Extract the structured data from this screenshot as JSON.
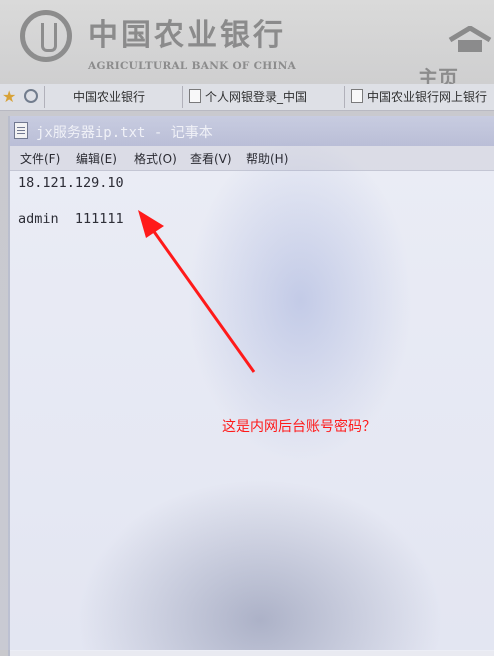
{
  "banner": {
    "bank_name_cn": "中国农业银行",
    "bank_name_en": "AGRICULTURAL BANK OF CHINA",
    "home_label": "主页"
  },
  "tabs": [
    {
      "label": "中国农业银行"
    },
    {
      "label": "个人网银登录_中国"
    },
    {
      "label": "中国农业银行网上银行"
    }
  ],
  "notepad": {
    "title": "jx服务器ip.txt - 记事本",
    "menu": [
      "文件(F)",
      "编辑(E)",
      "格式(O)",
      "查看(V)",
      "帮助(H)"
    ],
    "lines": [
      "18.121.129.10",
      "",
      "admin  111111"
    ]
  },
  "annotation": {
    "text": "这是内网后台账号密码？",
    "color": "#ff1a1a"
  }
}
